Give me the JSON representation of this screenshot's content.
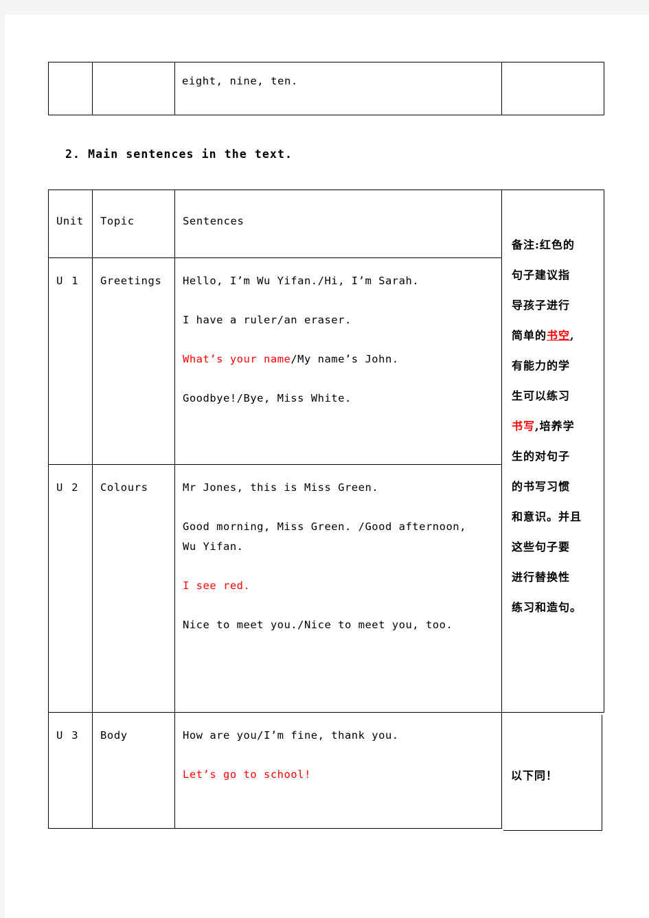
{
  "page": {
    "background": "#ffffff",
    "margin_background": "#f4f4f4",
    "accent_red": "#ff0000"
  },
  "top_table": {
    "unit": "",
    "topic": "",
    "sentences": "eight, nine, ten.",
    "note": ""
  },
  "section": {
    "number": "2.",
    "heading": "2. Main sentences in the text."
  },
  "main_table": {
    "headers": {
      "unit": "Unit",
      "topic": "Topic",
      "sentences": "Sentences",
      "note": ""
    },
    "rows": [
      {
        "unit": "U 1",
        "topic": "Greetings",
        "lines": [
          {
            "text": "Hello, I’m Wu Yifan./Hi, I’m Sarah.",
            "color": "black"
          },
          {
            "text": "I have a ruler/an eraser.",
            "color": "black"
          },
          {
            "text": "What’s your name/My name’s John.",
            "color": "mixed",
            "red_part": "What’s your name",
            "black_part": "/My name’s John."
          },
          {
            "text": "Goodbye!/Bye, Miss White.",
            "color": "black"
          }
        ]
      },
      {
        "unit": "U 2",
        "topic": "Colours",
        "lines": [
          {
            "text": "Mr Jones, this is Miss Green.",
            "color": "black"
          },
          {
            "text": "Good morning, Miss Green. /Good afternoon,",
            "color": "black"
          },
          {
            "text": "Wu Yifan.",
            "color": "black"
          },
          {
            "text": "I see red.",
            "color": "red"
          },
          {
            "text": "Nice to meet you./Nice to meet you, too.",
            "color": "black"
          }
        ]
      },
      {
        "unit": "U 3",
        "topic": "Body",
        "lines": [
          {
            "text": "How are you/I’m fine, thank you.",
            "color": "black"
          },
          {
            "text": "Let’s go to school!",
            "color": "red"
          }
        ]
      }
    ],
    "notes_column": {
      "lines": [
        {
          "segments": [
            {
              "text": "备注:红色的",
              "style": "black"
            }
          ]
        },
        {
          "segments": [
            {
              "text": "句子建议指",
              "style": "black"
            }
          ]
        },
        {
          "segments": [
            {
              "text": "导孩子进行",
              "style": "black"
            }
          ]
        },
        {
          "segments": [
            {
              "text": "简单的",
              "style": "black"
            },
            {
              "text": "书空",
              "style": "red-underline"
            },
            {
              "text": ",",
              "style": "black"
            }
          ]
        },
        {
          "segments": [
            {
              "text": "有能力的学",
              "style": "black"
            }
          ]
        },
        {
          "segments": [
            {
              "text": "生可以练习",
              "style": "black"
            }
          ]
        },
        {
          "segments": [
            {
              "text": "书写",
              "style": "red"
            },
            {
              "text": ",培养学",
              "style": "black"
            }
          ]
        },
        {
          "segments": [
            {
              "text": "生的对句子",
              "style": "black"
            }
          ]
        },
        {
          "segments": [
            {
              "text": "的书写习惯",
              "style": "black"
            }
          ]
        },
        {
          "segments": [
            {
              "text": "和意识。并且",
              "style": "black"
            }
          ]
        },
        {
          "segments": [
            {
              "text": "这些句子要",
              "style": "black"
            }
          ]
        },
        {
          "segments": [
            {
              "text": "进行替换性",
              "style": "black"
            }
          ]
        },
        {
          "segments": [
            {
              "text": "练习和造句。",
              "style": "black"
            }
          ]
        }
      ],
      "footer": "以下同！"
    }
  }
}
